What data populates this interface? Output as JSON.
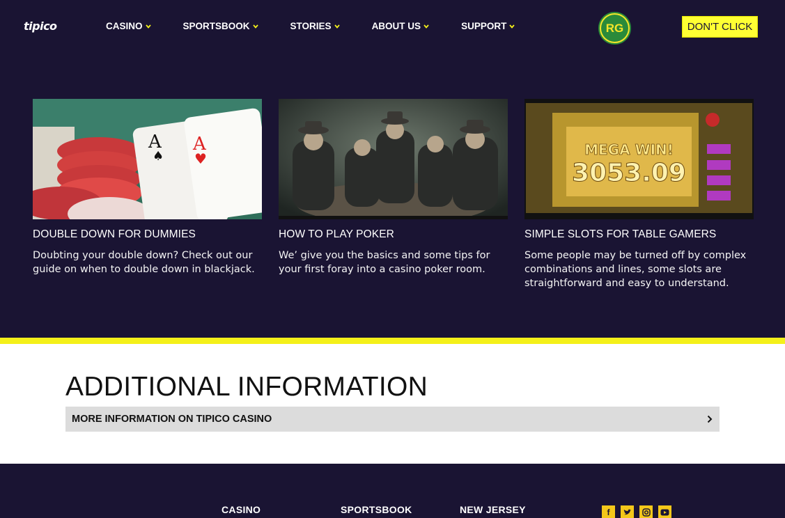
{
  "header": {
    "logo": "tipico",
    "nav": [
      {
        "label": "CASINO"
      },
      {
        "label": "SPORTSBOOK"
      },
      {
        "label": "STORIES"
      },
      {
        "label": "ABOUT US"
      },
      {
        "label": "SUPPORT"
      }
    ],
    "rg_badge": "RG",
    "dont_click_label": "DON'T CLICK"
  },
  "cards": [
    {
      "title": "DOUBLE DOWN FOR DUMMIES",
      "desc": "Doubting your double down? Check out our guide on when to double down in blackjack."
    },
    {
      "title": "HOW TO PLAY POKER",
      "desc": "We’ give you the basics and some tips for your first foray into a casino poker room."
    },
    {
      "title": "SIMPLE SLOTS FOR TABLE GAMERS",
      "desc": "Some people may be turned off by complex combinations and lines, some slots are straightforward and easy to understand."
    }
  ],
  "slot_image": {
    "big_text": "MEGA WIN!",
    "amount": "3053.09"
  },
  "additional": {
    "title": "ADDITIONAL INFORMATION",
    "accordion_label": "MORE INFORMATION ON TIPICO CASINO"
  },
  "footer": {
    "links": [
      "CASINO",
      "SPORTSBOOK",
      "NEW JERSEY"
    ],
    "social": [
      "facebook-icon",
      "twitter-icon",
      "instagram-icon",
      "youtube-icon"
    ]
  },
  "colors": {
    "bg": "#1a1433",
    "accent": "#f4f01a",
    "button": "#ffff33"
  }
}
